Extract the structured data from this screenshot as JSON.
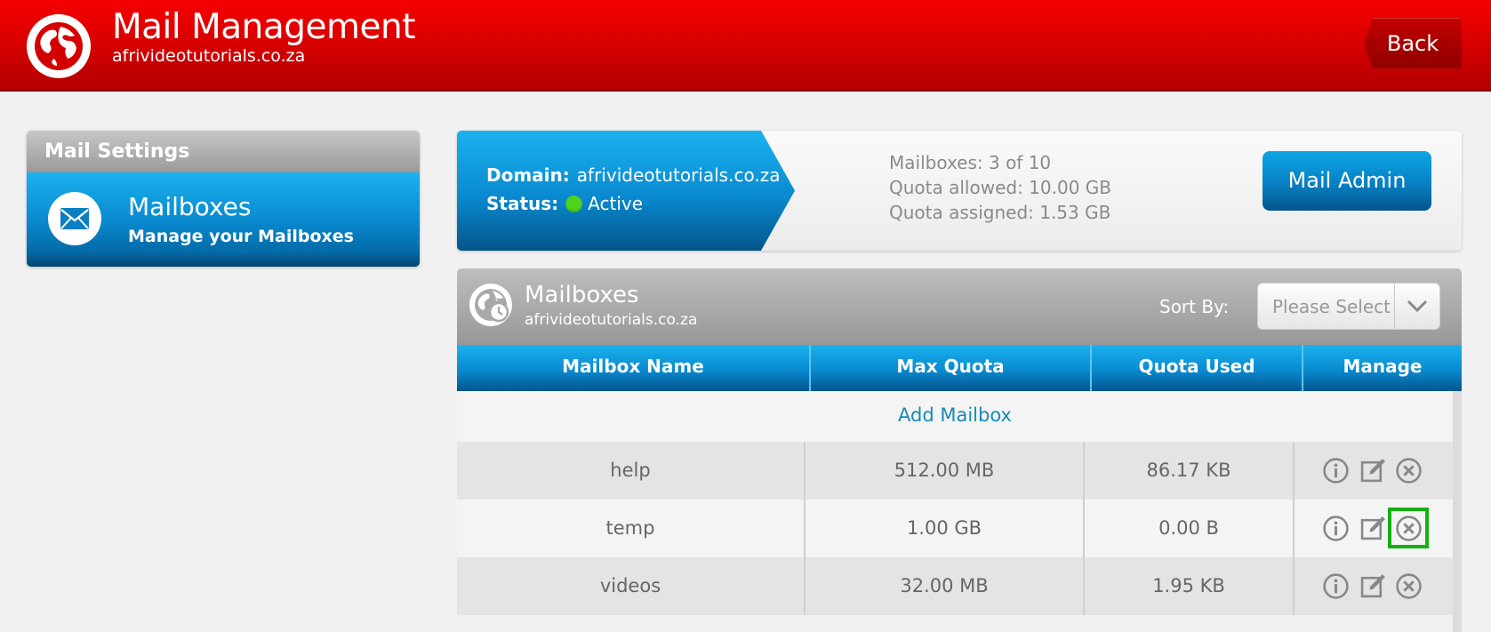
{
  "header": {
    "title": "Mail Management",
    "subtitle": "afrivideotutorials.co.za",
    "back_label": "Back",
    "logo_icon": "globe-icon"
  },
  "sidebar": {
    "title": "Mail Settings",
    "items": [
      {
        "title": "Mailboxes",
        "description": "Manage your Mailboxes",
        "icon": "envelope-icon"
      }
    ]
  },
  "domain_info": {
    "domain_label": "Domain:",
    "domain_value": "afrivideotutorials.co.za",
    "status_label": "Status:",
    "status_value": "Active",
    "status_color": "#4cd21f",
    "mailboxes_stat": "Mailboxes: 3 of 10",
    "quota_allowed": "Quota allowed: 10.00 GB",
    "quota_assigned": "Quota assigned: 1.53 GB",
    "mail_admin_label": "Mail Admin"
  },
  "mailboxes": {
    "title": "Mailboxes",
    "subtitle": "afrivideotutorials.co.za",
    "sort_label": "Sort By:",
    "sort_value": "Please Select",
    "columns": [
      "Mailbox Name",
      "Max Quota",
      "Quota Used",
      "Manage"
    ],
    "add_label": "Add Mailbox",
    "rows": [
      {
        "name": "help",
        "max_quota": "512.00 MB",
        "quota_used": "86.17 KB"
      },
      {
        "name": "temp",
        "max_quota": "1.00 GB",
        "quota_used": "0.00 B"
      },
      {
        "name": "videos",
        "max_quota": "32.00 MB",
        "quota_used": "1.95 KB"
      }
    ],
    "actions": [
      "info-icon",
      "edit-icon",
      "delete-icon"
    ]
  },
  "colors": {
    "header_red": "#e00000",
    "accent_blue": "#0a8ad0",
    "link_blue": "#168ab8",
    "highlight_green": "#14b012"
  }
}
